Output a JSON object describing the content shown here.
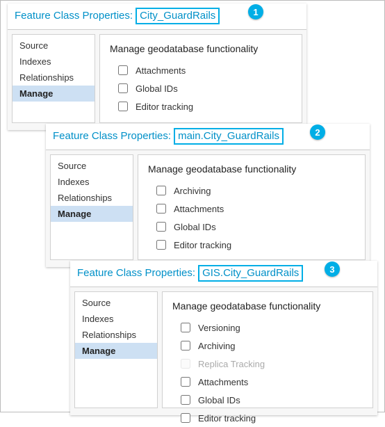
{
  "callouts": {
    "c1": "1",
    "c2": "2",
    "c3": "3"
  },
  "tabs": {
    "source": "Source",
    "indexes": "Indexes",
    "relationships": "Relationships",
    "manage": "Manage"
  },
  "section_title": "Manage geodatabase functionality",
  "panels": [
    {
      "title_prefix": "Feature Class Properties:",
      "fc_name": "City_GuardRails",
      "options": [
        {
          "label": "Attachments",
          "disabled": false
        },
        {
          "label": "Global IDs",
          "disabled": false
        },
        {
          "label": "Editor tracking",
          "disabled": false
        }
      ]
    },
    {
      "title_prefix": "Feature Class Properties:",
      "fc_name": "main.City_GuardRails",
      "options": [
        {
          "label": "Archiving",
          "disabled": false
        },
        {
          "label": "Attachments",
          "disabled": false
        },
        {
          "label": "Global IDs",
          "disabled": false
        },
        {
          "label": "Editor tracking",
          "disabled": false
        }
      ]
    },
    {
      "title_prefix": "Feature Class Properties:",
      "fc_name": "GIS.City_GuardRails",
      "options": [
        {
          "label": "Versioning",
          "disabled": false
        },
        {
          "label": "Archiving",
          "disabled": false
        },
        {
          "label": "Replica Tracking",
          "disabled": true
        },
        {
          "label": "Attachments",
          "disabled": false
        },
        {
          "label": "Global IDs",
          "disabled": false
        },
        {
          "label": "Editor tracking",
          "disabled": false
        }
      ]
    }
  ]
}
